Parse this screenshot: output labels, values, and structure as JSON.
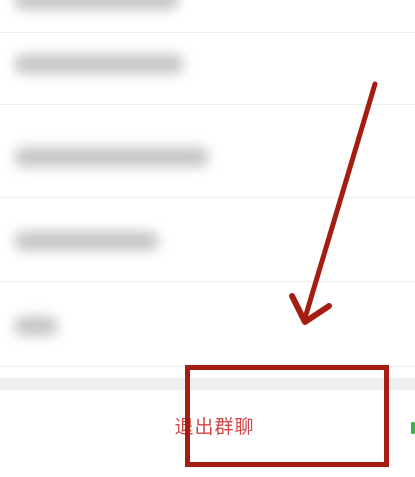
{
  "settings": {
    "exit_group_label": "退出群聊"
  },
  "colors": {
    "danger_text": "#d24646",
    "annotation": "#a51c12"
  }
}
